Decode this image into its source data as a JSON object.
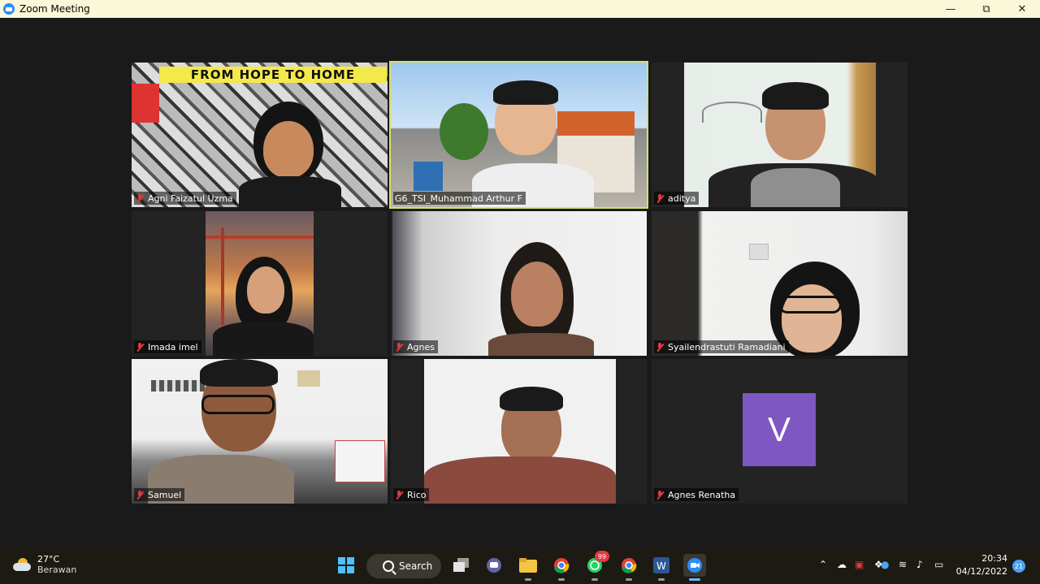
{
  "window": {
    "title": "Zoom Meeting",
    "controls": {
      "minimize": "—",
      "maximize": "⧉",
      "close": "✕"
    }
  },
  "participants": [
    {
      "name": "Agni Faizatul Uzma",
      "muted": true,
      "banner": "FROM HOPE TO HOME"
    },
    {
      "name": "G6_TSI_Muhammad Arthur F",
      "muted": false,
      "active_speaker": true
    },
    {
      "name": "aditya",
      "muted": true
    },
    {
      "name": "Imada imel",
      "muted": true
    },
    {
      "name": "Agnes",
      "muted": true
    },
    {
      "name": "Syailendrastuti Ramadiani",
      "muted": true
    },
    {
      "name": "Samuel",
      "muted": true
    },
    {
      "name": "Rico",
      "muted": true
    },
    {
      "name": "Agnes Renatha",
      "muted": true,
      "avatar_letter": "V",
      "avatar_color": "#7e57c2"
    }
  ],
  "taskbar": {
    "weather": {
      "temp": "27°C",
      "condition": "Berawan"
    },
    "search_label": "Search",
    "whatsapp_badge": "99",
    "tray_icons": [
      "chevron-up-icon",
      "onedrive-icon",
      "app-tray-icon",
      "dropbox-icon",
      "microphone-icon",
      "wifi-icon",
      "volume-icon",
      "battery-icon"
    ],
    "time": "20:34",
    "date": "04/12/2022",
    "notification_count": "21"
  },
  "colors": {
    "active_speaker_border": "#d5e06a",
    "muted_icon": "#e0393e",
    "title_bar": "#fbf7d9",
    "zoom_blue": "#2d8cff"
  }
}
